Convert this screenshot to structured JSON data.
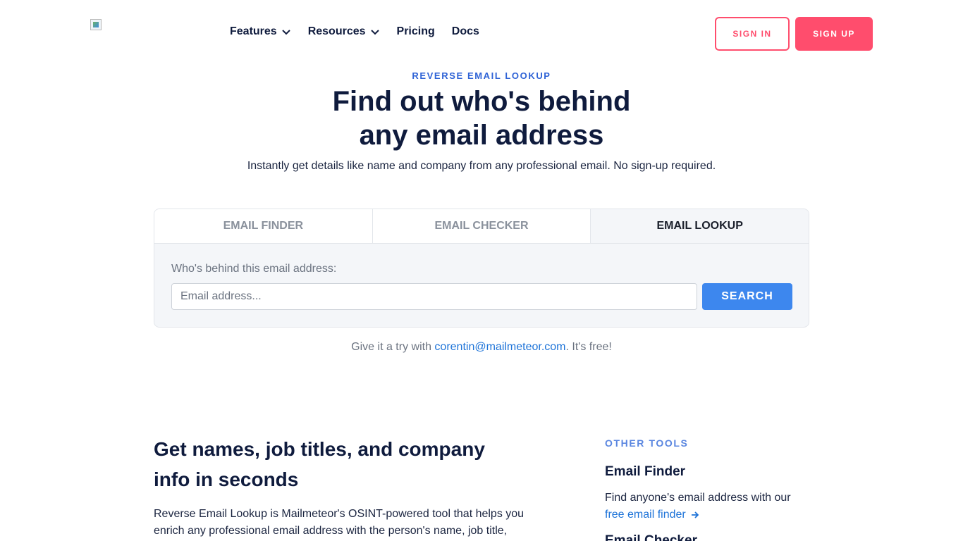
{
  "nav": {
    "features": "Features",
    "resources": "Resources",
    "pricing": "Pricing",
    "docs": "Docs",
    "sign_in": "SIGN IN",
    "sign_up": "SIGN UP",
    "logo_icon": "broken-image-icon"
  },
  "hero": {
    "eyebrow": "REVERSE EMAIL LOOKUP",
    "title_line1": "Find out who's behind",
    "title_line2": "any email address",
    "subtitle": "Instantly get details like name and company from any professional email. No sign-up required."
  },
  "tool": {
    "tabs": [
      "EMAIL FINDER",
      "EMAIL CHECKER",
      "EMAIL LOOKUP"
    ],
    "active_tab": "EMAIL LOOKUP",
    "label": "Who's behind this email address:",
    "placeholder": "Email address...",
    "search": "SEARCH",
    "try_prefix": "Give it a try with ",
    "try_email": "corentin@mailmeteor.com",
    "try_suffix": ". It's free!"
  },
  "section": {
    "title_line1": "Get names, job titles, and company",
    "title_line2": "info in seconds",
    "body_line1": "Reverse Email Lookup is Mailmeteor's OSINT-powered tool that helps you",
    "body_line2": "enrich any professional email address with the person's name, job title,"
  },
  "other_tools": {
    "eyebrow": "OTHER TOOLS",
    "items": [
      {
        "title": "Email Finder",
        "desc": "Find anyone's email address with our",
        "link": "free email finder"
      },
      {
        "title": "Email Checker"
      }
    ]
  },
  "colors": {
    "brand_pink": "#ff4d6d",
    "accent_blue": "#3d87ee",
    "link_blue": "#1d73d8",
    "heading_navy": "#0f1b3d"
  }
}
